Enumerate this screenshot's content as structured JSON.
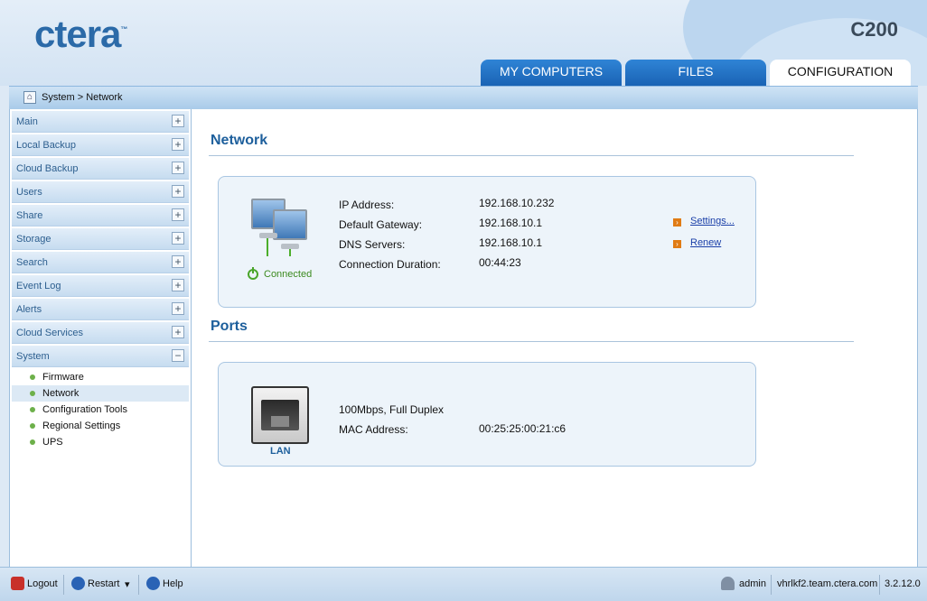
{
  "header": {
    "logo": "ctera",
    "logo_tm": "™",
    "model": "C200",
    "tabs": [
      {
        "label": "MY COMPUTERS"
      },
      {
        "label": "FILES"
      },
      {
        "label": "CONFIGURATION"
      }
    ]
  },
  "breadcrumb": "System > Network",
  "sidebar": {
    "items": [
      {
        "label": "Main"
      },
      {
        "label": "Local Backup"
      },
      {
        "label": "Cloud Backup"
      },
      {
        "label": "Users"
      },
      {
        "label": "Share"
      },
      {
        "label": "Storage"
      },
      {
        "label": "Search"
      },
      {
        "label": "Event Log"
      },
      {
        "label": "Alerts"
      },
      {
        "label": "Cloud Services"
      },
      {
        "label": "System"
      }
    ],
    "system_sub": [
      {
        "label": "Firmware"
      },
      {
        "label": "Network"
      },
      {
        "label": "Configuration Tools"
      },
      {
        "label": "Regional Settings"
      },
      {
        "label": "UPS"
      }
    ]
  },
  "network": {
    "title": "Network",
    "status": "Connected",
    "fields": [
      {
        "label": "IP Address:",
        "value": "192.168.10.232"
      },
      {
        "label": "Default Gateway:",
        "value": "192.168.10.1"
      },
      {
        "label": "DNS Servers:",
        "value": "192.168.10.1"
      },
      {
        "label": "Connection Duration:",
        "value": "00:44:23"
      }
    ],
    "actions": [
      {
        "label": "Settings..."
      },
      {
        "label": "Renew"
      }
    ]
  },
  "ports": {
    "title": "Ports",
    "port_label": "LAN",
    "speed": "100Mbps, Full Duplex",
    "mac_label": "MAC Address:",
    "mac_value": "00:25:25:00:21:c6"
  },
  "footer": {
    "logout": "Logout",
    "restart": "Restart",
    "restart_caret": "▾",
    "help": "Help",
    "user": "admin",
    "host": "vhrlkf2.team.ctera.com",
    "version": "3.2.12.0"
  }
}
